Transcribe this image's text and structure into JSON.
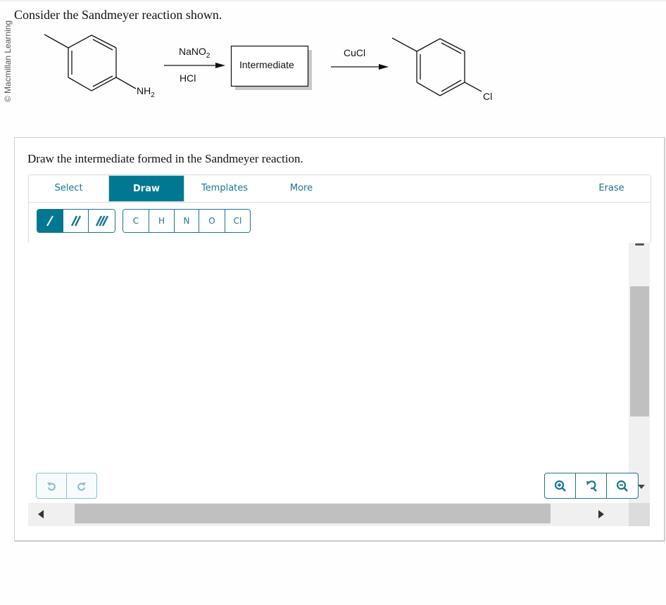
{
  "copyright": "© Macmillan Learning",
  "question": {
    "prompt": "Consider the Sandmeyer reaction shown.",
    "scheme": {
      "reactant": {
        "name": "4-methylaniline",
        "substituent_label": "NH",
        "substituent_sub": "2"
      },
      "step1": {
        "reagent_above": "NaNO",
        "reagent_above_sub": "2",
        "reagent_below": "HCl"
      },
      "intermediate_label": "Intermediate",
      "step2": {
        "reagent_above": "CuCl"
      },
      "product": {
        "name": "4-chlorotoluene",
        "substituent_label": "Cl"
      }
    },
    "instruction": "Draw the intermediate formed in the Sandmeyer reaction."
  },
  "editor": {
    "tabs": [
      {
        "label": "Select",
        "active": false
      },
      {
        "label": "Draw",
        "active": true
      },
      {
        "label": "Templates",
        "active": false
      },
      {
        "label": "More",
        "active": false
      },
      {
        "label": "Erase",
        "active": false
      }
    ],
    "bond_tools": [
      {
        "name": "single-bond",
        "active": true
      },
      {
        "name": "double-bond",
        "active": false
      },
      {
        "name": "triple-bond",
        "active": false
      }
    ],
    "atom_tools": [
      "C",
      "H",
      "N",
      "O",
      "Cl"
    ],
    "history": [
      {
        "name": "undo",
        "enabled": false
      },
      {
        "name": "redo",
        "enabled": false
      }
    ],
    "zoom_controls": [
      "zoom-in",
      "reset-zoom",
      "zoom-out"
    ],
    "accent_color": "#017891",
    "disabled_color": "#8cc1cf"
  }
}
